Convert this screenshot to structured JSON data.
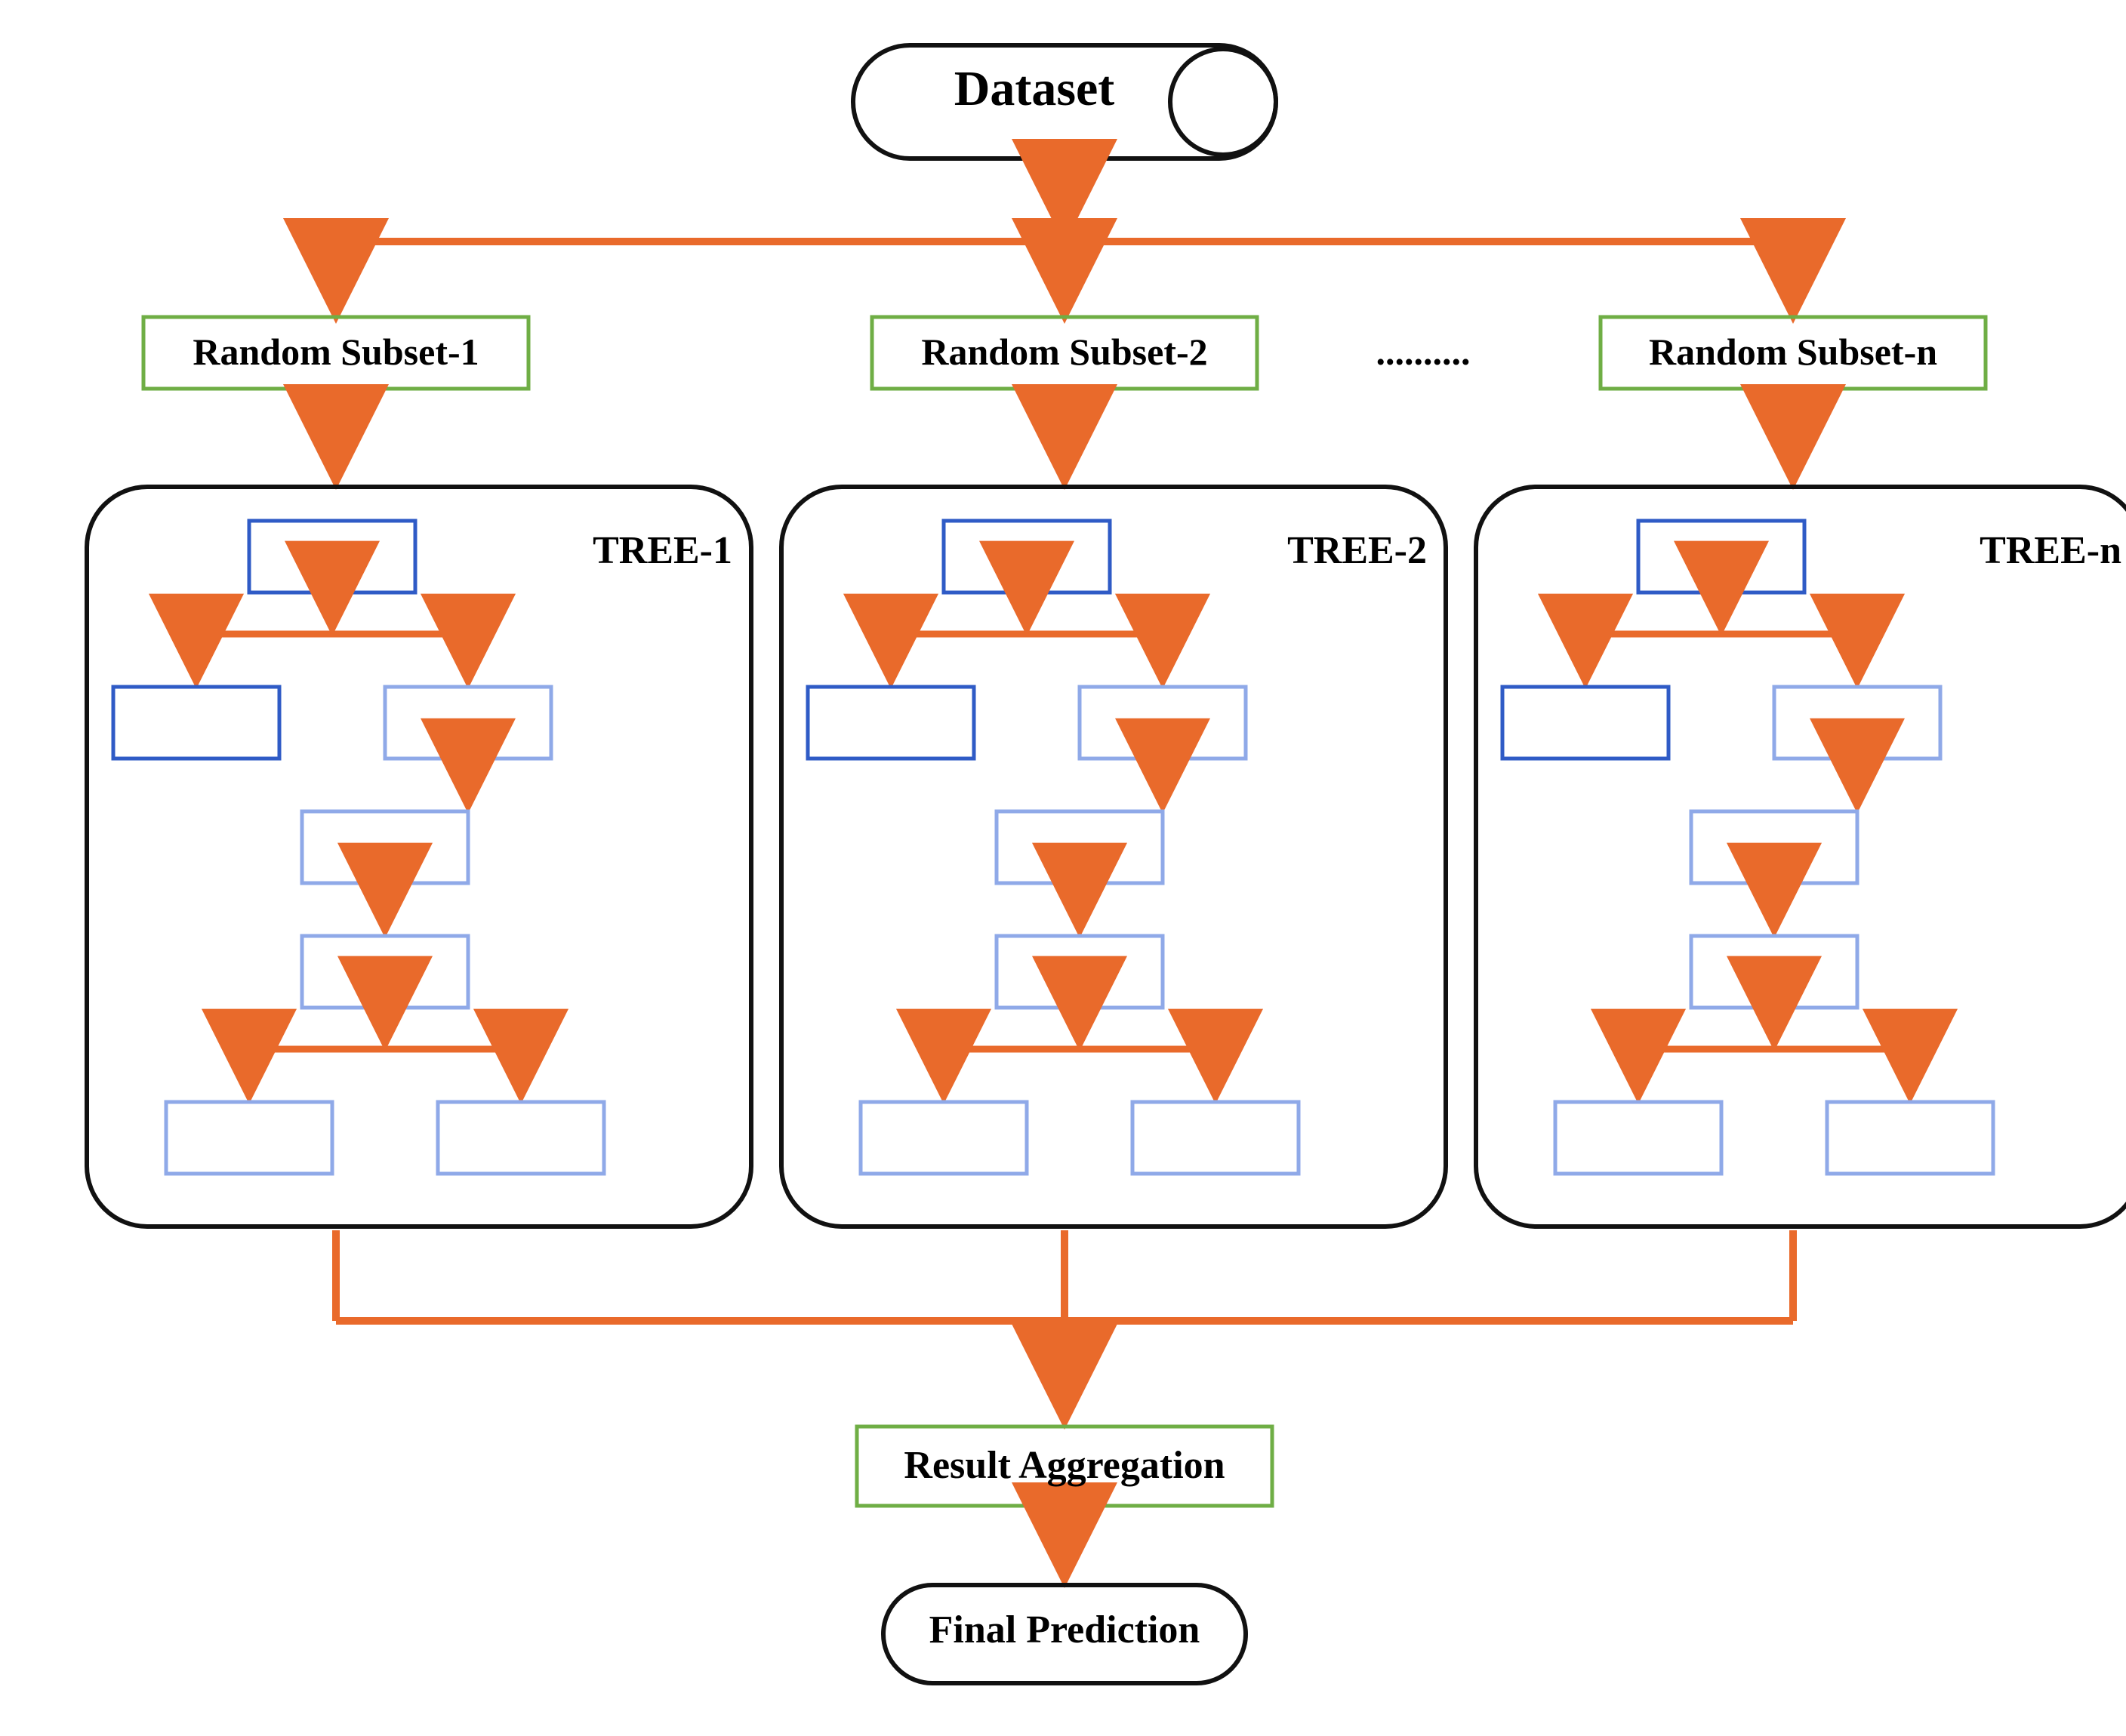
{
  "dataset": "Dataset",
  "subsets": [
    "Random Subset-1",
    "Random Subset-2",
    "Random Subset-n"
  ],
  "ellipsis": "..........",
  "trees": [
    "TREE-1",
    "TREE-2",
    "TREE-n"
  ],
  "result_agg": "Result Aggregation",
  "final_pred": "Final Prediction",
  "colors": {
    "arrow": "#E96A2B",
    "green": "#6FAE45",
    "blue": "#2F5BC6",
    "lightblue": "#8FA9E8",
    "black": "#111"
  }
}
